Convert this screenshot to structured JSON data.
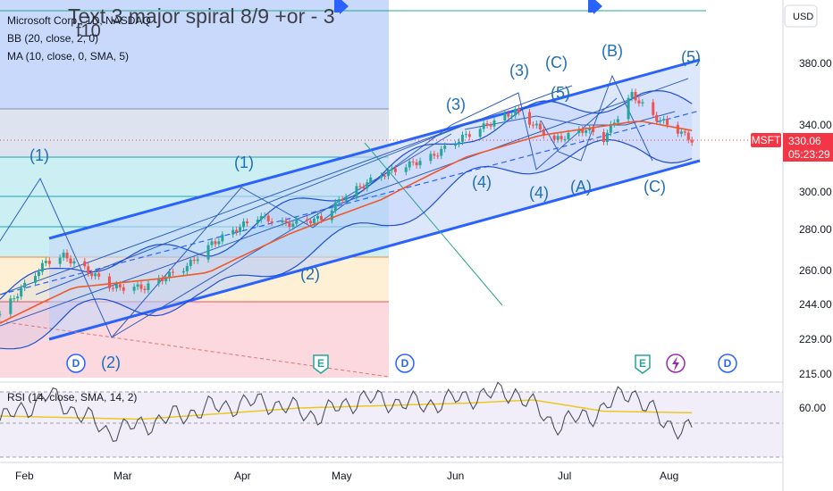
{
  "header": {
    "script_title": "Text 3 major spiral  8/9 +or - 3",
    "script_subtitle": "f10",
    "symbol_line": "Microsoft Corp., 1D, NASDAQ",
    "bb_line": "BB (20, close, 2, 0)",
    "ma_line": "MA (10, close, 0, SMA, 5)",
    "rsi_line": "RSI (14, close, SMA, 14, 2)"
  },
  "price_axis": {
    "currency": "USD",
    "labels": [
      "380.00",
      "340.00",
      "300.00",
      "280.00",
      "260.00",
      "244.00",
      "229.00",
      "215.00"
    ],
    "rsi_label": "60.00",
    "last_price": {
      "ticker": "MSFT",
      "price": "330.06",
      "countdown": "05:23:29"
    }
  },
  "time_axis": {
    "labels": [
      "Feb",
      "Mar",
      "Apr",
      "May",
      "Jun",
      "Jul",
      "Aug"
    ]
  },
  "wave_labels": [
    "(1)",
    "(1)",
    "(2)",
    "(2)",
    "(3)",
    "(3)",
    "(4)",
    "(4)",
    "(C)",
    "(5)",
    "(A)",
    "(B)",
    "(C)",
    "(5)"
  ],
  "event_markers": [
    "D",
    "E",
    "D",
    "E",
    "D"
  ],
  "colors": {
    "accent": "#2962ff",
    "wave_label": "#1e6fb8",
    "candle_up": "#26a69a",
    "candle_down": "#ef5350",
    "ma_line": "#f0592a",
    "rsi_line": "#4a4f63",
    "rsi_ma": "#e9c91f",
    "last_price_bg": "#f23645",
    "fib_cyan": "#cceff3",
    "fib_yellow": "#fdf0d5",
    "fib_red": "#fbd9de",
    "channel_fill": "#dbe6fb",
    "blue_zone": "#c9d9fb"
  },
  "chart_data": {
    "type": "candlestick",
    "title": "Microsoft Corp., 1D, NASDAQ",
    "x_range": [
      "2023-01-20",
      "2023-08-14"
    ],
    "y_scale": "log",
    "y_ticks": [
      215,
      229,
      244,
      260,
      280,
      300,
      340,
      380
    ],
    "close_path": [
      {
        "date": "2023-01-20",
        "close": 240
      },
      {
        "date": "2023-02-02",
        "close": 264
      },
      {
        "date": "2023-02-07",
        "close": 267
      },
      {
        "date": "2023-02-21",
        "close": 252
      },
      {
        "date": "2023-03-02",
        "close": 252
      },
      {
        "date": "2023-03-14",
        "close": 262
      },
      {
        "date": "2023-03-21",
        "close": 273
      },
      {
        "date": "2023-04-03",
        "close": 287
      },
      {
        "date": "2023-04-11",
        "close": 283
      },
      {
        "date": "2023-04-21",
        "close": 286
      },
      {
        "date": "2023-04-27",
        "close": 297
      },
      {
        "date": "2023-05-08",
        "close": 310
      },
      {
        "date": "2023-05-22",
        "close": 320
      },
      {
        "date": "2023-06-01",
        "close": 333
      },
      {
        "date": "2023-06-15",
        "close": 348
      },
      {
        "date": "2023-06-26",
        "close": 330
      },
      {
        "date": "2023-07-05",
        "close": 337
      },
      {
        "date": "2023-07-10",
        "close": 331
      },
      {
        "date": "2023-07-18",
        "close": 359
      },
      {
        "date": "2023-07-24",
        "close": 345
      },
      {
        "date": "2023-07-31",
        "close": 336
      },
      {
        "date": "2023-08-04",
        "close": 330
      }
    ],
    "moving_average": [
      {
        "date": "2023-01-20",
        "value": 236
      },
      {
        "date": "2023-02-10",
        "value": 252
      },
      {
        "date": "2023-03-06",
        "value": 256
      },
      {
        "date": "2023-03-20",
        "value": 259
      },
      {
        "date": "2023-04-12",
        "value": 278
      },
      {
        "date": "2023-05-08",
        "value": 296
      },
      {
        "date": "2023-06-01",
        "value": 320
      },
      {
        "date": "2023-06-22",
        "value": 333
      },
      {
        "date": "2023-07-20",
        "value": 342
      },
      {
        "date": "2023-08-04",
        "value": 336
      }
    ],
    "last_close": 330.06,
    "rsi": [
      {
        "date": "2023-01-20",
        "value": 52
      },
      {
        "date": "2023-02-03",
        "value": 68
      },
      {
        "date": "2023-02-20",
        "value": 45
      },
      {
        "date": "2023-03-02",
        "value": 50
      },
      {
        "date": "2023-03-20",
        "value": 60
      },
      {
        "date": "2023-04-05",
        "value": 64
      },
      {
        "date": "2023-04-20",
        "value": 55
      },
      {
        "date": "2023-05-02",
        "value": 66
      },
      {
        "date": "2023-05-20",
        "value": 62
      },
      {
        "date": "2023-06-05",
        "value": 68
      },
      {
        "date": "2023-06-15",
        "value": 70
      },
      {
        "date": "2023-06-26",
        "value": 50
      },
      {
        "date": "2023-07-06",
        "value": 55
      },
      {
        "date": "2023-07-18",
        "value": 71
      },
      {
        "date": "2023-07-27",
        "value": 50
      },
      {
        "date": "2023-08-04",
        "value": 47
      }
    ],
    "rsi_ma": [
      {
        "date": "2023-01-20",
        "value": 55
      },
      {
        "date": "2023-03-01",
        "value": 53
      },
      {
        "date": "2023-04-15",
        "value": 60
      },
      {
        "date": "2023-06-01",
        "value": 63
      },
      {
        "date": "2023-06-20",
        "value": 65
      },
      {
        "date": "2023-07-10",
        "value": 58
      },
      {
        "date": "2023-08-04",
        "value": 57
      }
    ],
    "rsi_levels": [
      60
    ]
  }
}
